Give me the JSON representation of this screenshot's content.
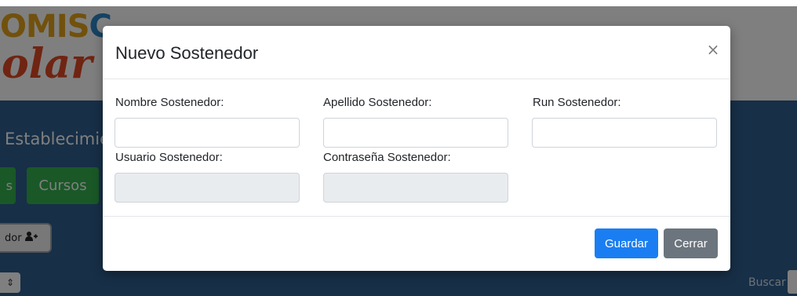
{
  "background": {
    "logo_top_main": "OMIS",
    "logo_top_accent": "C",
    "logo_bottom": "olar",
    "section_title": "Establecimie",
    "pill_left_label": "s",
    "cursos_button": "Cursos",
    "sostenedor_button": "dor",
    "select_arrow": "⇕",
    "buscar_label": "Buscar",
    "colors": {
      "band": "#2f5f8f",
      "green_button": "#35b14e",
      "logo_orange": "#e3a21a",
      "logo_blue": "#2d84c7",
      "logo_red": "#e04824"
    }
  },
  "modal": {
    "title": "Nuevo Sostenedor",
    "close_icon": "close-icon",
    "close_glyph": "×",
    "fields": {
      "nombre": {
        "label": "Nombre Sostenedor:",
        "value": ""
      },
      "apellido": {
        "label": "Apellido Sostenedor:",
        "value": ""
      },
      "run": {
        "label": "Run Sostenedor:",
        "value": ""
      },
      "usuario": {
        "label": "Usuario Sostenedor:",
        "value": ""
      },
      "contrasena": {
        "label": "Contraseña Sostenedor:",
        "value": ""
      }
    },
    "buttons": {
      "save_label": "Guardar",
      "close_label": "Cerrar"
    },
    "colors": {
      "save": "#1a7ef2",
      "close": "#6c757d",
      "readonly_field": "#e9ecef"
    }
  }
}
